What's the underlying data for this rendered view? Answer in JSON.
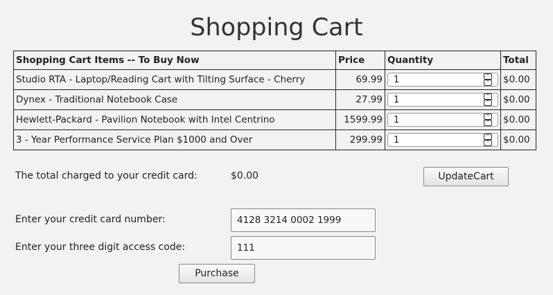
{
  "page_title": "Shopping Cart",
  "table": {
    "headers": [
      "Shopping Cart Items -- To Buy Now",
      "Price",
      "Quantity",
      "Total"
    ],
    "rows": [
      {
        "item": "Studio RTA - Laptop/Reading Cart with Tilting Surface - Cherry",
        "price": "69.99",
        "qty": "1",
        "total": "$0.00"
      },
      {
        "item": "Dynex - Traditional Notebook Case",
        "price": "27.99",
        "qty": "1",
        "total": "$0.00"
      },
      {
        "item": "Hewlett-Packard - Pavilion Notebook with Intel Centrino",
        "price": "1599.99",
        "qty": "1",
        "total": "$0.00"
      },
      {
        "item": "3 - Year Performance Service Plan $1000 and Over",
        "price": "299.99",
        "qty": "1",
        "total": "$0.00"
      }
    ]
  },
  "summary": {
    "total_label": "The total charged to your credit card:",
    "total_value": "$0.00",
    "update_button": "UpdateCart"
  },
  "payment": {
    "card_label": "Enter your credit card number:",
    "card_value": "4128 3214 0002 1999",
    "code_label": "Enter your three digit access code:",
    "code_value": "111",
    "purchase_button": "Purchase"
  },
  "icons": {
    "spin_up": "chevron-up-icon",
    "spin_down": "chevron-down-icon"
  }
}
